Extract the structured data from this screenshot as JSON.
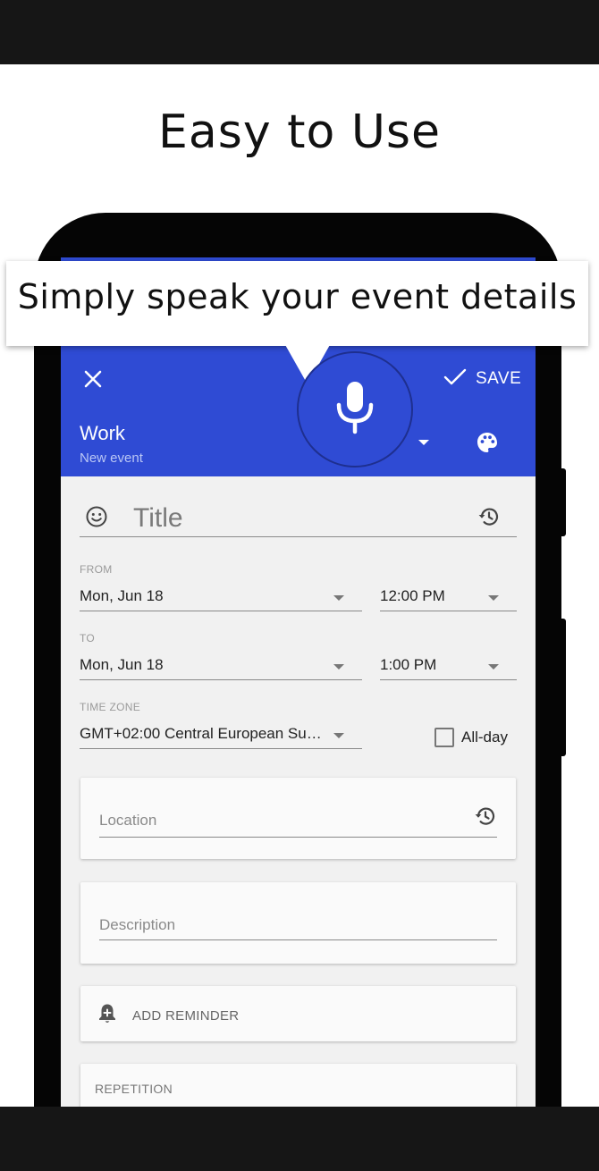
{
  "headline": "Easy to Use",
  "bubble": {
    "text": "Simply speak your event details"
  },
  "appbar": {
    "save_label": "SAVE",
    "calendar_name": "Work",
    "calendar_subtitle": "New event",
    "color": "#2f4bd4"
  },
  "form": {
    "title_placeholder": "Title",
    "from_label": "FROM",
    "from_date": "Mon, Jun 18",
    "from_time": "12:00 PM",
    "to_label": "TO",
    "to_date": "Mon, Jun 18",
    "to_time": "1:00 PM",
    "timezone_label": "TIME ZONE",
    "timezone_value": "GMT+02:00 Central European Su…",
    "allday_label": "All-day",
    "allday_checked": false,
    "location_placeholder": "Location",
    "description_placeholder": "Description",
    "add_reminder_label": "ADD REMINDER",
    "repetition_label": "REPETITION"
  },
  "icons": {
    "close": "close-icon",
    "save": "check-icon",
    "mic": "microphone-icon",
    "palette": "palette-icon",
    "smiley": "smiley-icon",
    "history": "history-icon",
    "reminder": "add-alarm-icon"
  }
}
